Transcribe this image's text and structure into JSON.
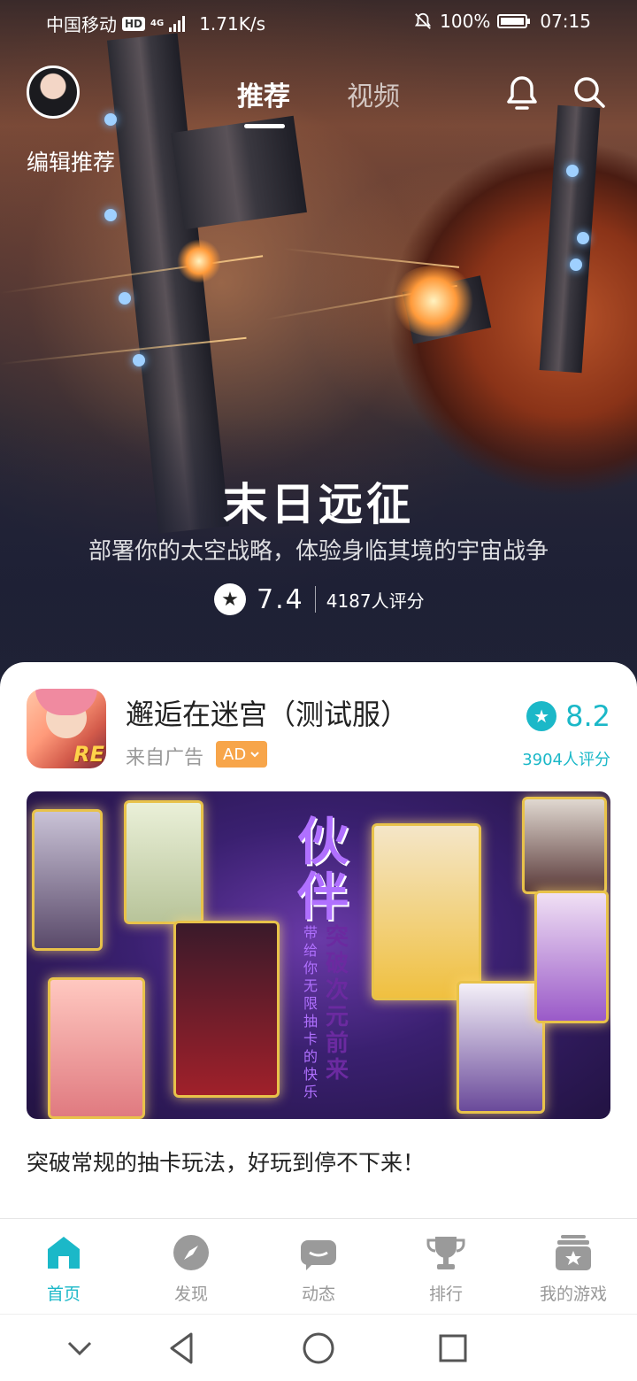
{
  "status_bar": {
    "carrier": "中国移动",
    "hd_badge": "HD",
    "network": "4G",
    "speed": "1.71K/s",
    "battery": "100%",
    "time": "07:15"
  },
  "header": {
    "editor_label": "编辑推荐",
    "tabs": [
      {
        "label": "推荐",
        "active": true
      },
      {
        "label": "视频",
        "active": false
      }
    ],
    "icons": [
      "bell-icon",
      "search-icon"
    ]
  },
  "hero": {
    "title": "末日远征",
    "subtitle": "部署你的太空战略，体验身临其境的宇宙战争",
    "score": "7.4",
    "rating_count": "4187人评分"
  },
  "card": {
    "app_title": "邂逅在迷宫（测试服）",
    "ad_source": "来自广告",
    "ad_badge": "AD",
    "icon_text": "RE",
    "score": "8.2",
    "rating_count": "3904人评分",
    "banner_headline": "伙伴",
    "banner_vertical_1": "突破次元前来",
    "banner_vertical_2": "带给你无限抽卡的快乐",
    "description": "突破常规的抽卡玩法，好玩到停不下来！"
  },
  "bottom_nav": [
    {
      "label": "首页",
      "icon": "home-icon",
      "active": true
    },
    {
      "label": "发现",
      "icon": "compass-icon",
      "active": false
    },
    {
      "label": "动态",
      "icon": "chat-icon",
      "active": false
    },
    {
      "label": "排行",
      "icon": "trophy-icon",
      "active": false
    },
    {
      "label": "我的游戏",
      "icon": "game-box-icon",
      "active": false
    }
  ],
  "colors": {
    "accent": "#1bb8c8",
    "ad_badge": "#f7a54a",
    "inactive_nav": "#999999"
  }
}
